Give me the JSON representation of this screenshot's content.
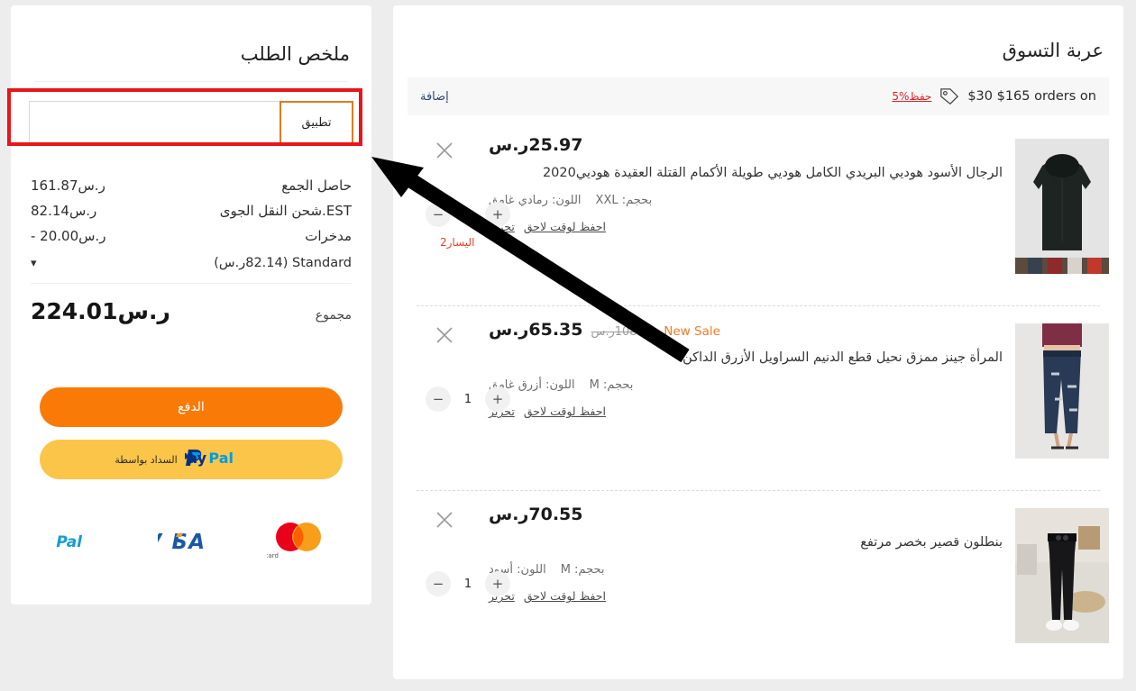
{
  "cart": {
    "title": "عربة التسوق",
    "promo": {
      "text": "$30 $165 orders on",
      "save_label": "حفظ%5",
      "add_label": "إضافة",
      "icon": "price-tag-icon",
      "save_color": "#d8232a",
      "add_color": "#2b4a6f"
    },
    "items": [
      {
        "price": "25.97ر.س",
        "old_price": "",
        "badge": "",
        "name": "الرجال الأسود هوديي البريدي الكامل هوديي طويلة الأكمام القتلة العقيدة هوديي2020",
        "color_label": "اللون:",
        "color_value": "رمادي غامق",
        "size_label": "بحجم:",
        "size_value": "XXL",
        "edit_label": "تجرير",
        "save_label": "احفظ لوقت لاحق",
        "qty": "1",
        "stock_warning": "اليسار2",
        "thumb": "hoodie-thumbnail"
      },
      {
        "price": "65.35ر.س",
        "old_price": "108.92ر.س",
        "badge": "New Sale",
        "name": "المرأة جينز ممزق نحيل قطع الدنيم السراويل الأزرق الداكن",
        "color_label": "اللون:",
        "color_value": "أزرق غامق",
        "size_label": "بحجم:",
        "size_value": "M",
        "edit_label": "تجرير",
        "save_label": "احفظ لوقت لاحق",
        "qty": "1",
        "stock_warning": "",
        "thumb": "jeans-thumbnail"
      },
      {
        "price": "70.55ر.س",
        "old_price": "",
        "badge": "",
        "name": "بنطلون قصير بخصر مرتفع",
        "color_label": "اللون:",
        "color_value": "أسود",
        "size_label": "بحجم:",
        "size_value": "M",
        "edit_label": "تجرير",
        "save_label": "احفظ لوقت لاحق",
        "qty": "1",
        "stock_warning": "",
        "thumb": "trousers-thumbnail"
      }
    ],
    "qty_plus": "+",
    "qty_minus": "−"
  },
  "summary": {
    "title": "ملخص الطلب",
    "coupon": {
      "value": "",
      "placeholder": "",
      "apply_label": "تطبيق"
    },
    "rows": [
      {
        "label": "حاصل الجمع",
        "value": "161.87ر.س"
      },
      {
        "label": "EST.شحن النقل الجوى",
        "value": "82.14ر.س"
      },
      {
        "label": "مدخرات",
        "value": "- 20.00ر.س"
      }
    ],
    "shipping_method": "Standard (82.14ر.س)",
    "shipping_chevron": "chevron-down-icon",
    "grand_label": "مجموع",
    "grand_value": "224.01ر.س",
    "checkout_label": "الدفع",
    "paypal_label": "السداد بواسطة",
    "cards": [
      "paypal-logo",
      "visa-logo",
      "mastercard-logo"
    ]
  },
  "annotations": {
    "highlight_color": "#e8151b",
    "arrow_color": "#000000"
  }
}
